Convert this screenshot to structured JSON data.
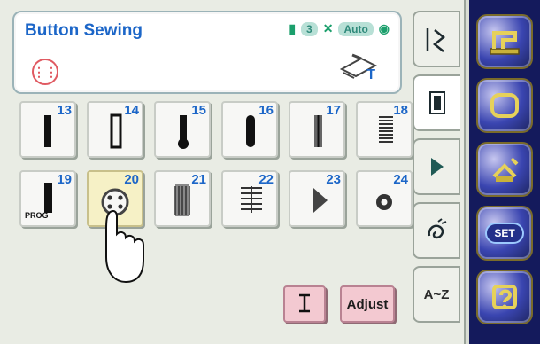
{
  "title": "Button Sewing",
  "status": {
    "pill_1": "3",
    "auto": "Auto",
    "foot_letter": "T"
  },
  "stitches": [
    {
      "num": "13",
      "name": "buttonhole-13"
    },
    {
      "num": "14",
      "name": "buttonhole-14"
    },
    {
      "num": "15",
      "name": "buttonhole-15"
    },
    {
      "num": "16",
      "name": "buttonhole-16"
    },
    {
      "num": "17",
      "name": "buttonhole-17"
    },
    {
      "num": "18",
      "name": "buttonhole-18"
    },
    {
      "num": "19",
      "name": "buttonhole-19",
      "tag": "PROG"
    },
    {
      "num": "20",
      "name": "button-sewing-20",
      "selected": true
    },
    {
      "num": "21",
      "name": "stitch-21"
    },
    {
      "num": "22",
      "name": "stitch-22"
    },
    {
      "num": "23",
      "name": "stitch-23"
    },
    {
      "num": "24",
      "name": "stitch-24"
    }
  ],
  "actions": {
    "adjust": "Adjust"
  },
  "tabs": {
    "alpha": "A~Z"
  },
  "panel": {
    "set": "SET"
  }
}
